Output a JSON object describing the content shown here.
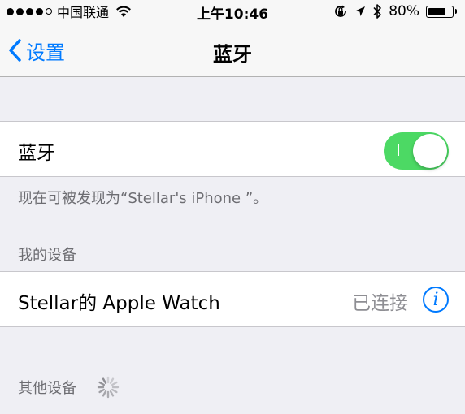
{
  "status_bar": {
    "signal_dots_filled": 4,
    "signal_dots_total": 5,
    "carrier": "中国联通",
    "time": "上午10:46",
    "battery_percent_text": "80%",
    "battery_level": 0.8,
    "icons": [
      "wifi-icon",
      "orientation-lock-icon",
      "location-icon",
      "bluetooth-icon",
      "battery-icon"
    ]
  },
  "nav": {
    "back_label": "设置",
    "title": "蓝牙"
  },
  "bluetooth_cell": {
    "label": "蓝牙",
    "toggle_on": true
  },
  "discoverable_text": "现在可被发现为“Stellar's iPhone ”。",
  "my_devices": {
    "header": "我的设备",
    "devices": [
      {
        "name": "Stellar的 Apple Watch",
        "status": "已连接",
        "info_glyph": "i"
      }
    ]
  },
  "other_devices": {
    "header": "其他设备",
    "searching": true
  },
  "colors": {
    "accent": "#007aff",
    "toggle_on": "#4cd964",
    "background": "#efeff4",
    "secondary_text": "#6d6d72"
  }
}
